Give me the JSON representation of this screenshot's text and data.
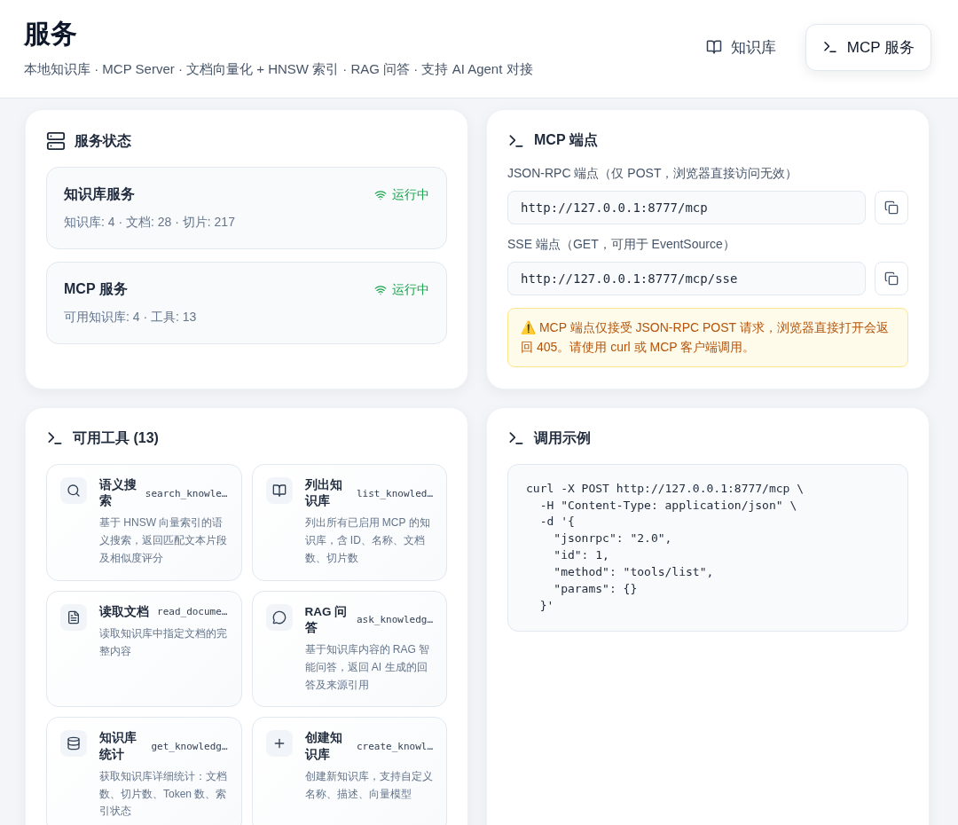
{
  "header": {
    "title": "服务",
    "subtitle": "本地知识库 · MCP Server · 文档向量化 + HNSW 索引 · RAG 问答 · 支持 AI Agent 对接"
  },
  "nav": [
    {
      "label": "知识库",
      "selected": false
    },
    {
      "label": "MCP 服务",
      "selected": true
    }
  ],
  "status_card": {
    "title": "服务状态",
    "services": [
      {
        "name": "知识库服务",
        "status": "运行中",
        "running": true,
        "detail": "知识库: 4 · 文档: 28 · 切片: 217"
      },
      {
        "name": "MCP 服务",
        "status": "运行中",
        "running": true,
        "detail": "可用知识库: 4 · 工具: 13"
      }
    ]
  },
  "endpoint_card": {
    "title": "MCP 端点",
    "endpoints": [
      {
        "label": "JSON-RPC 端点（仅 POST，浏览器直接访问无效）",
        "url": "http://127.0.0.1:8777/mcp"
      },
      {
        "label": "SSE 端点（GET，可用于 EventSource）",
        "url": "http://127.0.0.1:8777/mcp/sse"
      }
    ],
    "warning": "⚠️ MCP 端点仅接受 JSON-RPC POST 请求，浏览器直接打开会返回 405。请使用 curl 或 MCP 客户端调用。"
  },
  "tools_card": {
    "title": "可用工具 (13)",
    "tools": [
      {
        "kind": "search",
        "name": "语义搜索",
        "id": "search_knowle…",
        "description": "基于 HNSW 向量索引的语义搜索，返回匹配文本片段及相似度评分"
      },
      {
        "kind": "book",
        "name": "列出知识库",
        "id": "list_knowled…",
        "description": "列出所有已启用 MCP 的知识库，含 ID、名称、文档数、切片数"
      },
      {
        "kind": "document",
        "name": "读取文档",
        "id": "read_docume…",
        "description": "读取知识库中指定文档的完整内容"
      },
      {
        "kind": "chat",
        "name": "RAG 问答",
        "id": "ask_knowledg…",
        "description": "基于知识库内容的 RAG 智能问答，返回 AI 生成的回答及来源引用"
      },
      {
        "kind": "database",
        "name": "知识库统计",
        "id": "get_knowledg…",
        "description": "获取知识库详细统计：文档数、切片数、Token 数、索引状态"
      },
      {
        "kind": "plus",
        "name": "创建知识库",
        "id": "create_knowl…",
        "description": "创建新知识库，支持自定义名称、描述、向量模型"
      }
    ]
  },
  "example_card": {
    "title": "调用示例",
    "code": "curl -X POST http://127.0.0.1:8777/mcp \\\n  -H \"Content-Type: application/json\" \\\n  -d '{\n    \"jsonrpc\": \"2.0\",\n    \"id\": 1,\n    \"method\": \"tools/list\",\n    \"params\": {}\n  }'"
  }
}
